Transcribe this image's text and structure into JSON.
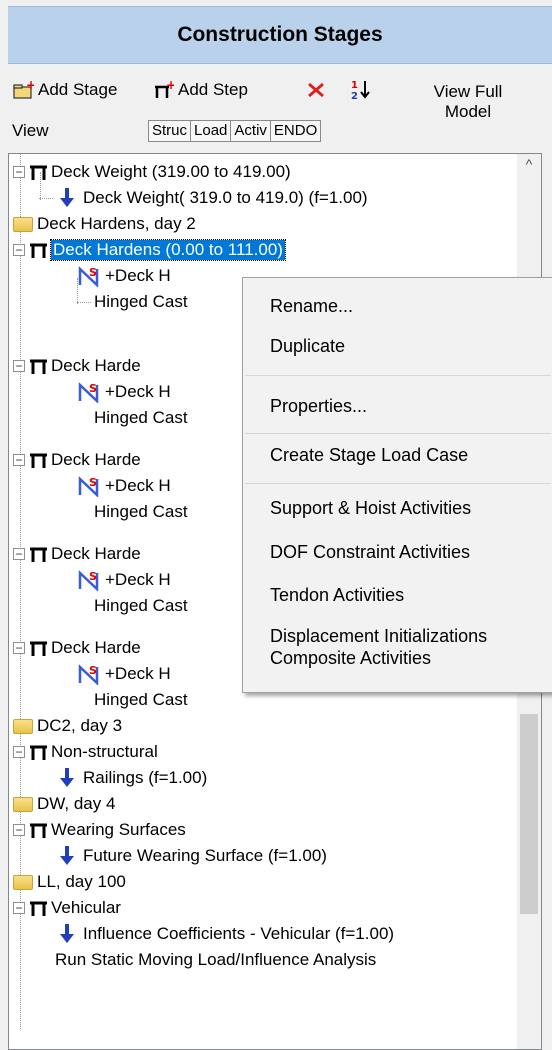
{
  "panel": {
    "title": "Construction Stages"
  },
  "toolbar": {
    "add_stage": "Add Stage",
    "add_step": "Add Step",
    "view_label": "View",
    "view_full_line1": "View Full",
    "view_full_line2": "Model",
    "tabs": [
      "Struc",
      "Load",
      "Activ",
      "ENDO"
    ]
  },
  "tree": {
    "rows": [
      "Deck Weight (319.00 to 419.00)",
      "Deck Weight( 319.0 to  419.0) (f=1.00)",
      "Deck Hardens, day 2",
      "Deck Hardens (0.00 to 111.00)",
      "+Deck H",
      "Hinged Cast",
      "Deck Harde",
      "+Deck H",
      "Hinged Cast",
      "Deck Harde",
      "+Deck H",
      "Hinged Cast",
      "Deck Harde",
      "+Deck H",
      "Hinged Cast",
      "Deck Harde",
      "+Deck H",
      "Hinged Cast",
      "DC2, day 3",
      "Non-structural",
      "Railings (f=1.00)",
      "DW, day 4",
      "Wearing Surfaces",
      "Future Wearing Surface (f=1.00)",
      "LL, day 100",
      "Vehicular",
      "Influence Coefficients - Vehicular (f=1.00)",
      "Run Static Moving Load/Influence Analysis"
    ]
  },
  "context_menu": {
    "items": [
      "Rename...",
      "Duplicate",
      "Properties...",
      "Create Stage Load Case",
      "Support & Hoist Activities",
      "DOF Constraint Activities",
      "Tendon Activities",
      "Displacement Initializations",
      "Composite Activities"
    ]
  },
  "colors": {
    "header_bg": "#b9d1ea",
    "selection": "#0078d7",
    "load_arrow": "#1f3fbf"
  }
}
